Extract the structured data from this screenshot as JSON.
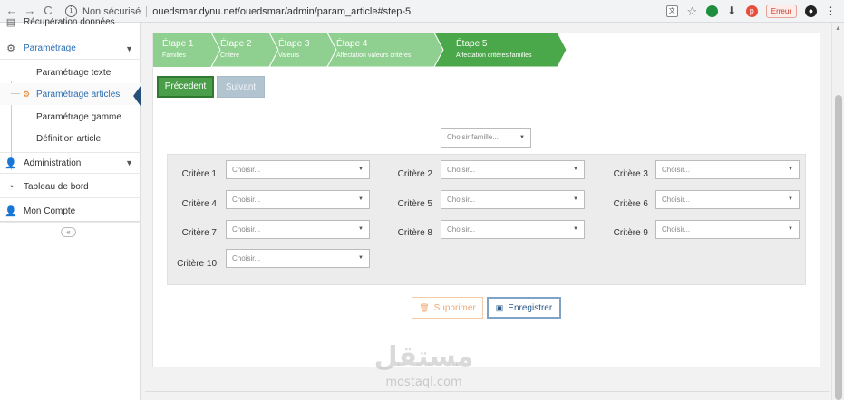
{
  "browser": {
    "back": "←",
    "forward": "→",
    "reload": "C",
    "security_label": "Non sécurisé",
    "url": "ouedsmar.dynu.net/ouedsmar/admin/param_article#step-5",
    "error_label": "Erreur"
  },
  "sidebar": {
    "items": [
      {
        "label": "Récupération données",
        "icon": "download-icon"
      },
      {
        "label": "Paramétrage",
        "icon": "gears-icon"
      },
      {
        "label": "Administration",
        "icon": "user-icon"
      },
      {
        "label": "Tableau de bord",
        "icon": "dashboard-icon"
      },
      {
        "label": "Mon Compte",
        "icon": "user-icon"
      }
    ],
    "subitems": [
      {
        "label": "Paramétrage texte"
      },
      {
        "label": "Paramétrage articles"
      },
      {
        "label": "Paramétrage gamme"
      },
      {
        "label": "Définition article"
      }
    ],
    "collapse_glyph": "«"
  },
  "wizard": {
    "steps": [
      {
        "num": "Étape 1",
        "sub": "Familles"
      },
      {
        "num": "Étape 2",
        "sub": "Critère"
      },
      {
        "num": "Étape 3",
        "sub": "Valeurs"
      },
      {
        "num": "Étape 4",
        "sub": "Affectation valeurs critères"
      },
      {
        "num": "Étape 5",
        "sub": "Affectation critères familles"
      }
    ],
    "active_step": 5,
    "prev_label": "Précedent",
    "next_label": "Suivant"
  },
  "family_select": {
    "value": "Choisir famille..."
  },
  "criteria": [
    {
      "label": "Critère 1",
      "value": "Choisir..."
    },
    {
      "label": "Critère 2",
      "value": "Choisir..."
    },
    {
      "label": "Critère 3",
      "value": "Choisir..."
    },
    {
      "label": "Critère 4",
      "value": "Choisir..."
    },
    {
      "label": "Critère 5",
      "value": "Choisir..."
    },
    {
      "label": "Critère 6",
      "value": "Choisir..."
    },
    {
      "label": "Critère 7",
      "value": "Choisir..."
    },
    {
      "label": "Critère 8",
      "value": "Choisir..."
    },
    {
      "label": "Critère 9",
      "value": "Choisir..."
    },
    {
      "label": "Critère 10",
      "value": "Choisir..."
    }
  ],
  "actions": {
    "delete_label": "Supprimer",
    "save_label": "Enregistrer"
  },
  "watermark": {
    "arabic": "مستقل",
    "latin": "mostaql.com"
  },
  "colors": {
    "step_done": "#8fcf8f",
    "step_active": "#4aa84a",
    "primary_green": "#4a9e4a",
    "save_blue": "#2d5a87",
    "delete_orange": "#f0a873"
  }
}
